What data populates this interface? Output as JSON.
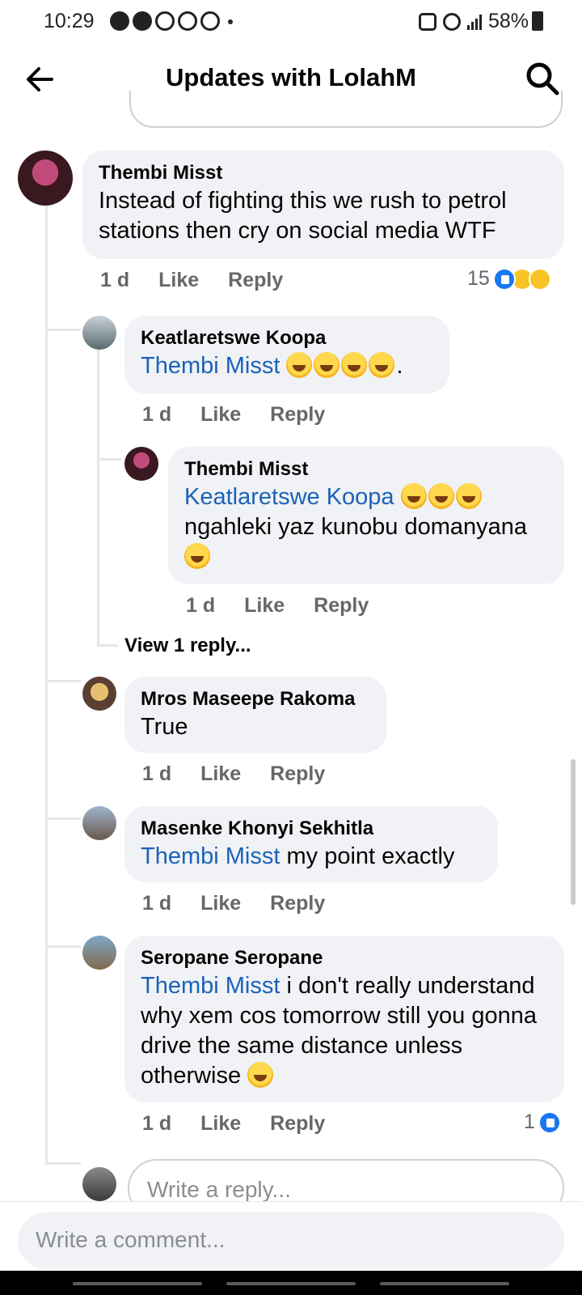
{
  "status_bar": {
    "time": "10:29",
    "battery": "58%"
  },
  "header": {
    "title": "Updates with LolahM",
    "back_icon": "arrow-left-icon",
    "search_icon": "search-icon"
  },
  "comments": [
    {
      "author": "Thembi Misst",
      "text": "Instead of fighting this we rush to petrol stations then cry on social media WTF",
      "time": "1 d",
      "like": "Like",
      "reply": "Reply",
      "reaction_count": "15",
      "reactions": [
        "like",
        "haha",
        "sad"
      ]
    },
    {
      "author": "Keatlaretswe Koopa",
      "mention": "Thembi Misst",
      "text_after": ".",
      "emoji_count": 4,
      "time": "1 d",
      "like": "Like",
      "reply": "Reply"
    },
    {
      "author": "Thembi Misst",
      "mention": "Keatlaretswe Koopa",
      "text": "ngahleki yaz kunobu domanyana",
      "time": "1 d",
      "like": "Like",
      "reply": "Reply"
    },
    {
      "author": "Mros Maseepe Rakoma",
      "text": "True",
      "time": "1 d",
      "like": "Like",
      "reply": "Reply"
    },
    {
      "author": "Masenke Khonyi Sekhitla",
      "mention": "Thembi Misst",
      "text": "my point exactly",
      "time": "1 d",
      "like": "Like",
      "reply": "Reply"
    },
    {
      "author": "Seropane Seropane",
      "mention": "Thembi Misst",
      "text": "i don't really understand why xem cos tomorrow still you gonna drive the same distance unless otherwise",
      "time": "1 d",
      "like": "Like",
      "reply": "Reply",
      "reaction_count": "1"
    }
  ],
  "view_replies": "View 1 reply...",
  "reply_placeholder": "Write a reply...",
  "comment_placeholder": "Write a comment...",
  "colors": {
    "bubble": "#f0f2f5",
    "mention": "#1c62b9",
    "meta": "#65676b",
    "like_blue": "#1877f2"
  }
}
